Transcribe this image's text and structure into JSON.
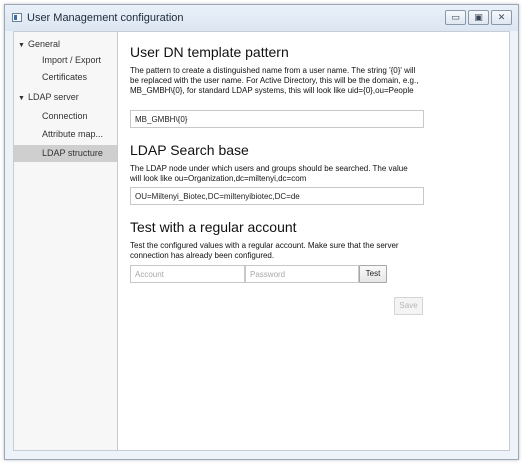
{
  "window": {
    "title": "User Management configuration",
    "minimize_glyph": "▭",
    "maximize_glyph": "▣",
    "close_glyph": "✕"
  },
  "sidebar": {
    "items": [
      {
        "label": "General",
        "level": 0,
        "expanded": true,
        "selected": false
      },
      {
        "label": "Import / Export",
        "level": 1,
        "selected": false
      },
      {
        "label": "Certificates",
        "level": 1,
        "selected": false
      },
      {
        "label": "LDAP server",
        "level": 0,
        "expanded": true,
        "selected": false
      },
      {
        "label": "Connection",
        "level": 1,
        "selected": false
      },
      {
        "label": "Attribute map...",
        "level": 1,
        "selected": false
      },
      {
        "label": "LDAP structure",
        "level": 1,
        "selected": true
      }
    ]
  },
  "sections": {
    "dn_template": {
      "heading": "User DN template pattern",
      "description": "The pattern to create a distinguished name from a user name. The string '{0}' will be replaced with the user name. For Active Directory, this will be the domain, e.g., MB_GMBH\\{0}, for standard LDAP systems, this will look like uid={0},ou=People",
      "value": "MB_GMBH\\{0}"
    },
    "search_base": {
      "heading": "LDAP Search base",
      "description": "The LDAP node under which users and groups should be searched. The value will look like ou=Organization,dc=miltenyi,dc=com",
      "value": "OU=Miltenyi_Biotec,DC=miltenyibiotec,DC=de"
    },
    "test": {
      "heading": "Test with a regular account",
      "description": "Test the configured values with a regular account. Make sure that the server connection has already been configured.",
      "account_placeholder": "Account",
      "password_placeholder": "Password",
      "test_label": "Test"
    }
  },
  "save_label": "Save"
}
